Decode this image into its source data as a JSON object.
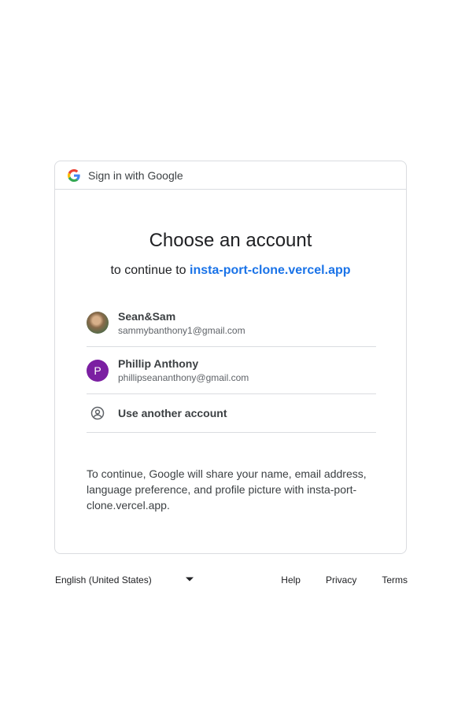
{
  "header": {
    "title": "Sign in with Google",
    "logo_icon": "google-g-icon"
  },
  "main": {
    "title": "Choose an account",
    "subtitle_prefix": "to continue to",
    "app_name": "insta-port-clone.vercel.app"
  },
  "accounts": [
    {
      "name": "Sean&Sam",
      "email": "sammybanthony1@gmail.com",
      "avatar": "photo"
    },
    {
      "name": "Phillip Anthony",
      "email": "phillipseananthony@gmail.com",
      "avatar_letter": "P",
      "avatar_color": "#7b1fa2"
    }
  ],
  "another_account": {
    "label": "Use another account",
    "icon": "account-circle-icon"
  },
  "disclaimer": "To continue, Google will share your name, email address, language preference, and profile picture with insta-port-clone.vercel.app.",
  "footer": {
    "language": "English (United States)",
    "links": [
      "Help",
      "Privacy",
      "Terms"
    ]
  },
  "colors": {
    "link": "#1a73e8",
    "border": "#dadce0"
  }
}
